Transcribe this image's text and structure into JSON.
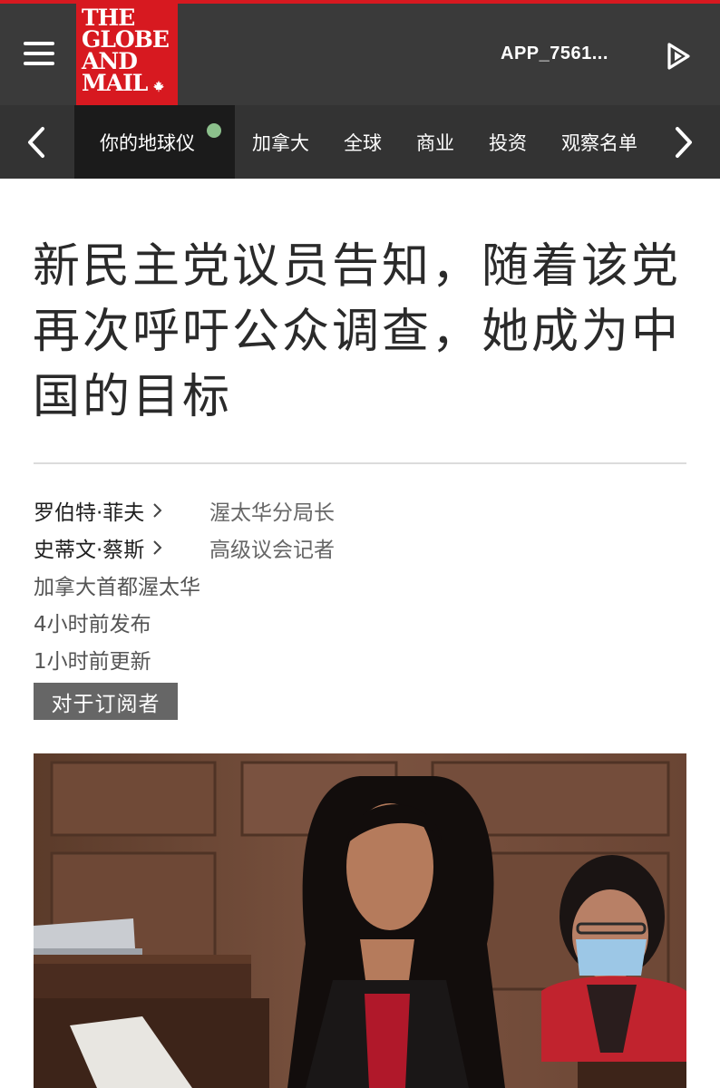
{
  "header": {
    "logo_lines": [
      "THE",
      "GLOBE",
      "AND",
      "MAIL"
    ],
    "app_id": "APP_7561..."
  },
  "nav": {
    "items": [
      {
        "label": "你的地球仪",
        "active": true
      },
      {
        "label": "加拿大",
        "active": false
      },
      {
        "label": "全球",
        "active": false
      },
      {
        "label": "商业",
        "active": false
      },
      {
        "label": "投资",
        "active": false
      },
      {
        "label": "观察名单",
        "active": false
      }
    ],
    "active_dot_color": "#8cc08c"
  },
  "article": {
    "headline": "新民主党议员告知，随着该党再次呼吁公众调查，她成为中国的目标",
    "authors": [
      {
        "name": "罗伯特·菲夫",
        "role": "渥太华分局长"
      },
      {
        "name": "史蒂文·蔡斯",
        "role": "高级议会记者"
      }
    ],
    "location": "加拿大首都渥太华",
    "published": "4小时前发布",
    "updated": "1小时前更新",
    "subscriber_badge": "对于订阅者"
  },
  "colors": {
    "brand_red": "#d71920",
    "header_bg": "#3a3a3a",
    "nav_bg": "#333333",
    "nav_active_bg": "#1b1b1b"
  }
}
